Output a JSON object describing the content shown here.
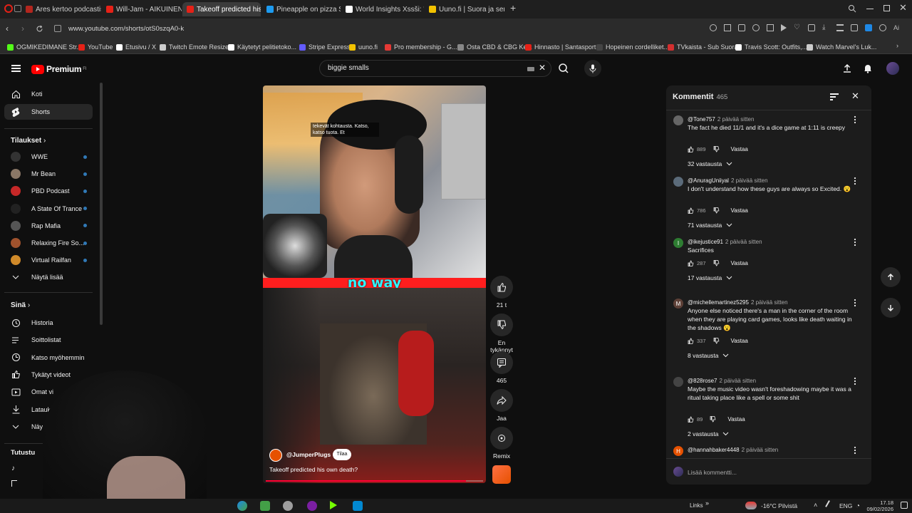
{
  "browser": {
    "tabs": [
      {
        "label": "Ares kertoo podcastissa ...",
        "color": "#b3261e"
      },
      {
        "label": "Will-Jam - AIKUINEN - Yo",
        "color": "#e62117"
      },
      {
        "label": "Takeoff predicted his",
        "color": "#e62117"
      },
      {
        "label": "Pineapple on pizza Steam",
        "color": "#1d9bf0"
      },
      {
        "label": "World Insights Xssši: \"Ker",
        "color": "#ffffff"
      },
      {
        "label": "Uuno.fi | Suora ja sensuro",
        "color": "#f2c200"
      }
    ],
    "new_tab": "+",
    "url": "www.youtube.com/shorts/otS0szqA0-k",
    "bookmarks": [
      {
        "label": "OGMIKEDIMANE Str...",
        "color": "#53fc18"
      },
      {
        "label": "YouTube",
        "color": "#e62117"
      },
      {
        "label": "Etusivu / X",
        "color": "#ffffff"
      },
      {
        "label": "Twitch Emote Resizer",
        "color": "#cccccc"
      },
      {
        "label": "Käytetyt pelitietoko...",
        "color": "#ffffff"
      },
      {
        "label": "Stripe Express",
        "color": "#635bff"
      },
      {
        "label": "uuno.fi",
        "color": "#f2c200"
      },
      {
        "label": "Pro membership - G...",
        "color": "#e53935"
      },
      {
        "label": "Osta CBD & CBG Ke...",
        "color": "#888888"
      },
      {
        "label": "Hinnasto | Santasport",
        "color": "#e62117"
      },
      {
        "label": "Hopeinen cordelliket...",
        "color": "#444444"
      },
      {
        "label": "TVkaista - Sub Suora",
        "color": "#d32f2f"
      },
      {
        "label": "Travis Scott: Outfits,...",
        "color": "#ffffff"
      },
      {
        "label": "Watch Marvel's Luk...",
        "color": "#cccccc"
      }
    ]
  },
  "youtube": {
    "logo_text": "Premium",
    "logo_sup": "FI",
    "search_value": "biggie smalls"
  },
  "sidebar": {
    "main": [
      {
        "label": "Koti",
        "icon": "home-icon"
      },
      {
        "label": "Shorts",
        "icon": "shorts-icon"
      }
    ],
    "subs_title": "Tilaukset",
    "subs": [
      {
        "label": "WWE",
        "color": "#333333"
      },
      {
        "label": "Mr Bean",
        "color": "#8a7766"
      },
      {
        "label": "PBD Podcast",
        "color": "#c62828"
      },
      {
        "label": "A State Of Trance",
        "color": "#222222"
      },
      {
        "label": "Rap Mafia",
        "color": "#555555"
      },
      {
        "label": "Relaxing Fire So...",
        "color": "#a0522d"
      },
      {
        "label": "Virtual Railfan",
        "color": "#d08a2a"
      }
    ],
    "show_more": "Näytä lisää",
    "you_title": "Sinä",
    "you": [
      {
        "label": "Historia",
        "icon": "history-icon"
      },
      {
        "label": "Soittolistat",
        "icon": "playlist-icon"
      },
      {
        "label": "Katso myöhemmin",
        "icon": "clock-icon"
      },
      {
        "label": "Tykätyt videot",
        "icon": "like-icon"
      },
      {
        "label": "Omat vi",
        "icon": "video-icon"
      },
      {
        "label": "Latauk",
        "icon": "download-icon"
      },
      {
        "label": "Näy",
        "icon": "chevron-down-icon"
      }
    ],
    "explore_title": "Tutustu"
  },
  "video": {
    "overlay_text": "tekevät kohtausta. Katso, katso tuota. Et",
    "caption": "no way",
    "channel": "@JumperPlugs",
    "subscribe": "Tilaa",
    "title": "Takeoff predicted his own death?"
  },
  "actions": {
    "like_count": "21 t",
    "dislike_label": "En tykännyt",
    "comments_count": "465",
    "share_label": "Jaa",
    "remix_label": "Remix"
  },
  "comments": {
    "title": "Kommentit",
    "count": "465",
    "items": [
      {
        "author": "@Tone757",
        "time": "2 päivää sitten",
        "text": "The fact he died 11/1 and it's a dice game at 1:11 is creepy",
        "likes": "889",
        "reply": "Vastaa",
        "replies": "32 vastausta",
        "color": "#666666"
      },
      {
        "author": "@AnuragUniiyal",
        "time": "2 päivää sitten",
        "text": "I don't understand how these guys are always so Excited. 😮",
        "likes": "786",
        "reply": "Vastaa",
        "replies": "71 vastausta",
        "color": "#5b6b7a"
      },
      {
        "author": "@ikejustice91",
        "time": "2 päivää sitten",
        "text": "Sacrifices",
        "likes": "287",
        "reply": "Vastaa",
        "replies": "17 vastausta",
        "color": "#2e7d32",
        "initial": "I"
      },
      {
        "author": "@michellemartinez5295",
        "time": "2 päivää sitten",
        "text": "Anyone else noticed there's a man in the corner of the room when they are playing card games, looks like death waiting in the shadows 😮",
        "likes": "337",
        "reply": "Vastaa",
        "replies": "8 vastausta",
        "color": "#5d4037",
        "initial": "M"
      },
      {
        "author": "@828rose7",
        "time": "2 päivää sitten",
        "text": "Maybe the music video wasn't foreshadowing maybe it was a ritual taking place like a spell or some shit",
        "likes": "89",
        "reply": "Vastaa",
        "replies": "2 vastausta",
        "color": "#444444"
      },
      {
        "author": "@hannahbaker4448",
        "time": "2 päivää sitten",
        "text": "",
        "likes": "",
        "reply": "",
        "replies": "",
        "color": "#e65100",
        "initial": "H"
      }
    ],
    "add_placeholder": "Lisää kommentti..."
  },
  "taskbar": {
    "links_label": "Links",
    "weather": "-16°C  Pilvistä",
    "lang": "ENG",
    "time": "17.18",
    "date": "09/02/2026"
  }
}
